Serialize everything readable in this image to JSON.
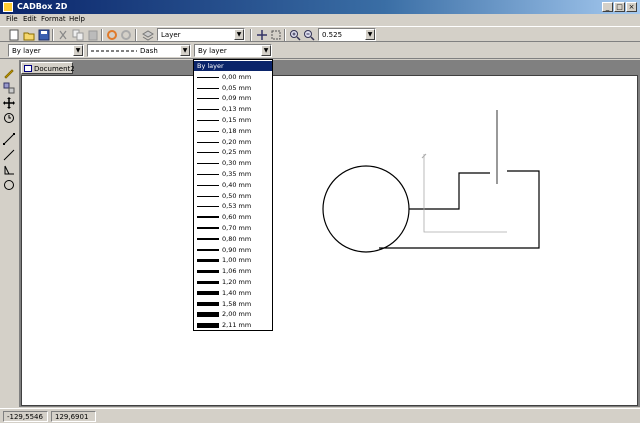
{
  "window": {
    "title": "CADBox 2D",
    "minimize": "_",
    "maximize": "□",
    "close": "×"
  },
  "menu": [
    "File",
    "Edit",
    "Format",
    "Help"
  ],
  "toolbar": {
    "icons": [
      "new-file-icon",
      "open-file-icon",
      "save-icon",
      "cut-icon",
      "copy-icon",
      "paste-icon",
      "undo-icon",
      "redo-icon",
      "layers-icon",
      "pan-icon",
      "select-rect-icon",
      "zoom-in-icon",
      "zoom-out-icon"
    ],
    "layer_value": "Layer",
    "zoom_value": "0.525"
  },
  "props": {
    "color_value": "By layer",
    "linetype_value": "Dash",
    "lineweight_value": "By layer"
  },
  "left_tools": [
    "pencil-icon",
    "blocks-icon",
    "move-icon",
    "rotate-icon",
    "line-icon",
    "polyline-icon",
    "dimension-icon",
    "circle-icon"
  ],
  "document": {
    "tab_label": "Document2"
  },
  "lineweight_options": [
    {
      "label": "By layer",
      "weight": 0
    },
    {
      "label": "0,00 mm",
      "weight": 1
    },
    {
      "label": "0,05 mm",
      "weight": 1
    },
    {
      "label": "0,09 mm",
      "weight": 1
    },
    {
      "label": "0,13 mm",
      "weight": 1
    },
    {
      "label": "0,15 mm",
      "weight": 1
    },
    {
      "label": "0,18 mm",
      "weight": 1
    },
    {
      "label": "0,20 mm",
      "weight": 1
    },
    {
      "label": "0,25 mm",
      "weight": 1
    },
    {
      "label": "0,30 mm",
      "weight": 1
    },
    {
      "label": "0,35 mm",
      "weight": 1
    },
    {
      "label": "0,40 mm",
      "weight": 1
    },
    {
      "label": "0,50 mm",
      "weight": 1
    },
    {
      "label": "0,53 mm",
      "weight": 1
    },
    {
      "label": "0,60 mm",
      "weight": 2
    },
    {
      "label": "0,70 mm",
      "weight": 2
    },
    {
      "label": "0,80 mm",
      "weight": 2
    },
    {
      "label": "0,90 mm",
      "weight": 2
    },
    {
      "label": "1,00 mm",
      "weight": 3
    },
    {
      "label": "1,06 mm",
      "weight": 3
    },
    {
      "label": "1,20 mm",
      "weight": 3
    },
    {
      "label": "1,40 mm",
      "weight": 4
    },
    {
      "label": "1,58 mm",
      "weight": 4
    },
    {
      "label": "2,00 mm",
      "weight": 5
    },
    {
      "label": "2,11 mm",
      "weight": 5
    }
  ],
  "status": {
    "x": "-129,5546",
    "y": "129,6901"
  }
}
